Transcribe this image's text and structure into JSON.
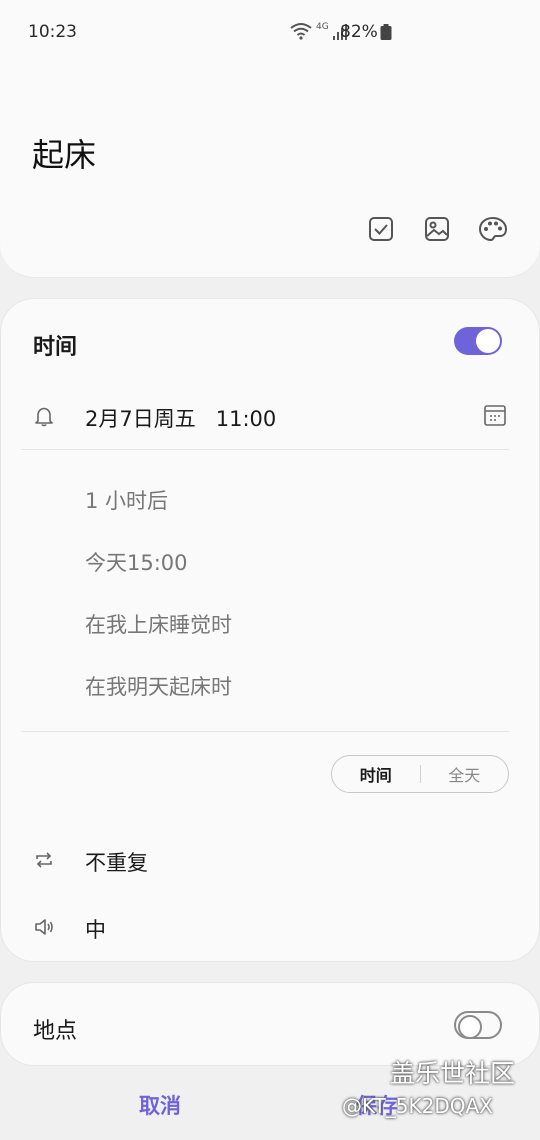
{
  "status_bar": {
    "time": "10:23",
    "network": "4G",
    "battery": "82%"
  },
  "reminder": {
    "title": "起床"
  },
  "header_tools": {
    "icons": [
      "checkbox-icon",
      "image-icon",
      "palette-icon"
    ]
  },
  "time_section": {
    "title": "时间",
    "toggle_on": true,
    "datetime": "2月7日周五   11:00",
    "suggestions": [
      "1 小时后",
      "今天15:00",
      "在我上床睡觉时",
      "在我明天起床时"
    ],
    "mode_tabs": [
      "时间",
      "全天"
    ],
    "selected_mode": "时间",
    "repeat": "不重复",
    "volume": "中"
  },
  "location_section": {
    "title": "地点",
    "toggle_on": false
  },
  "actions": {
    "cancel": "取消",
    "save": "保存"
  },
  "watermark": {
    "main": "盖乐世社区",
    "sub": "@KT_5K2DQAX"
  },
  "colors": {
    "accent": "#6f63d9",
    "background": "#f0f0f0",
    "card": "#fafafa"
  }
}
